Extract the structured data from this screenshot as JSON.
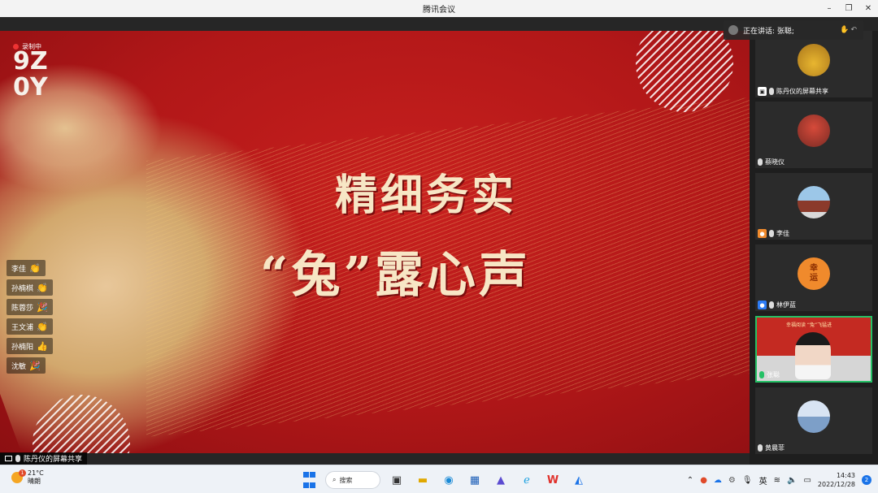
{
  "window": {
    "title": "腾讯会议",
    "controls": [
      "–",
      "❐",
      "✕"
    ]
  },
  "share_screen": {
    "rec_label": "录制中",
    "logo_text": "9Z\n0Y",
    "headline_line1": "精细务实",
    "headline_line2": "“兔”露心声",
    "sharer_label": "陈丹仪的屏幕共享"
  },
  "reactions": [
    {
      "name": "李佳",
      "emoji": "👏"
    },
    {
      "name": "孙楠棋",
      "emoji": "👏"
    },
    {
      "name": "陈蓉莎",
      "emoji": "🎉"
    },
    {
      "name": "王文浦",
      "emoji": "👏"
    },
    {
      "name": "孙楠阳",
      "emoji": "👍"
    },
    {
      "name": "沈敏",
      "emoji": "🎉"
    }
  ],
  "speaking_bar": {
    "label": "正在讲话: 张聪;"
  },
  "participants": [
    {
      "name": "陈丹仪的屏幕共享",
      "badge": "screen"
    },
    {
      "name": "蔡晓仪",
      "badge": "mic"
    },
    {
      "name": "李佳",
      "badge": "user-orange"
    },
    {
      "name": "林伊蓝",
      "badge": "user-blue",
      "avatar_text": [
        "幸",
        "运"
      ]
    },
    {
      "name": "张聪",
      "badge": "mic-active",
      "video_banner": "幸福阅读 “兔”飞猛进"
    },
    {
      "name": "黄晨菲",
      "badge": "mic"
    }
  ],
  "taskbar": {
    "weather_temp": "21°C",
    "weather_desc": "晴朗",
    "weather_badge": "1",
    "search_label": "搜索",
    "ime": "英",
    "time": "14:43",
    "date": "2022/12/28",
    "notifications": "2"
  }
}
